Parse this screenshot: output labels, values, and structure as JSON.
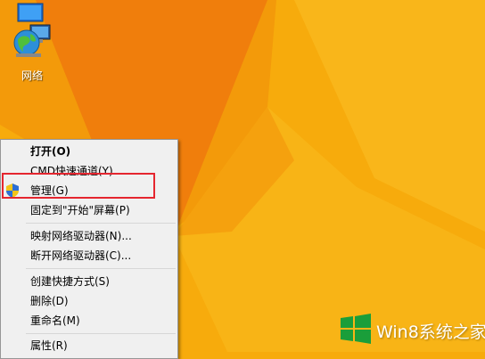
{
  "desktop": {
    "background_color": "#f7ab0c",
    "icons": [
      {
        "label": "网络",
        "icon": "network-globe-icon"
      },
      {
        "label": "",
        "icon": "this-pc-icon"
      }
    ]
  },
  "context_menu": {
    "items": [
      {
        "label": "打开(O)",
        "bold": true
      },
      {
        "label": "CMD快速通道(Y)"
      },
      {
        "label": "管理(G)",
        "icon": "uac-shield-icon",
        "highlighted": true
      },
      {
        "label": "固定到\"开始\"屏幕(P)"
      },
      {
        "label": "映射网络驱动器(N)..."
      },
      {
        "label": "断开网络驱动器(C)..."
      },
      {
        "label": "创建快捷方式(S)"
      },
      {
        "label": "删除(D)"
      },
      {
        "label": "重命名(M)"
      },
      {
        "label": "属性(R)"
      }
    ]
  },
  "highlight_color": "#e5262f",
  "watermark": {
    "text": "Win8系统之家",
    "logo": "windows-logo-icon",
    "color": "#1a9e3a"
  }
}
